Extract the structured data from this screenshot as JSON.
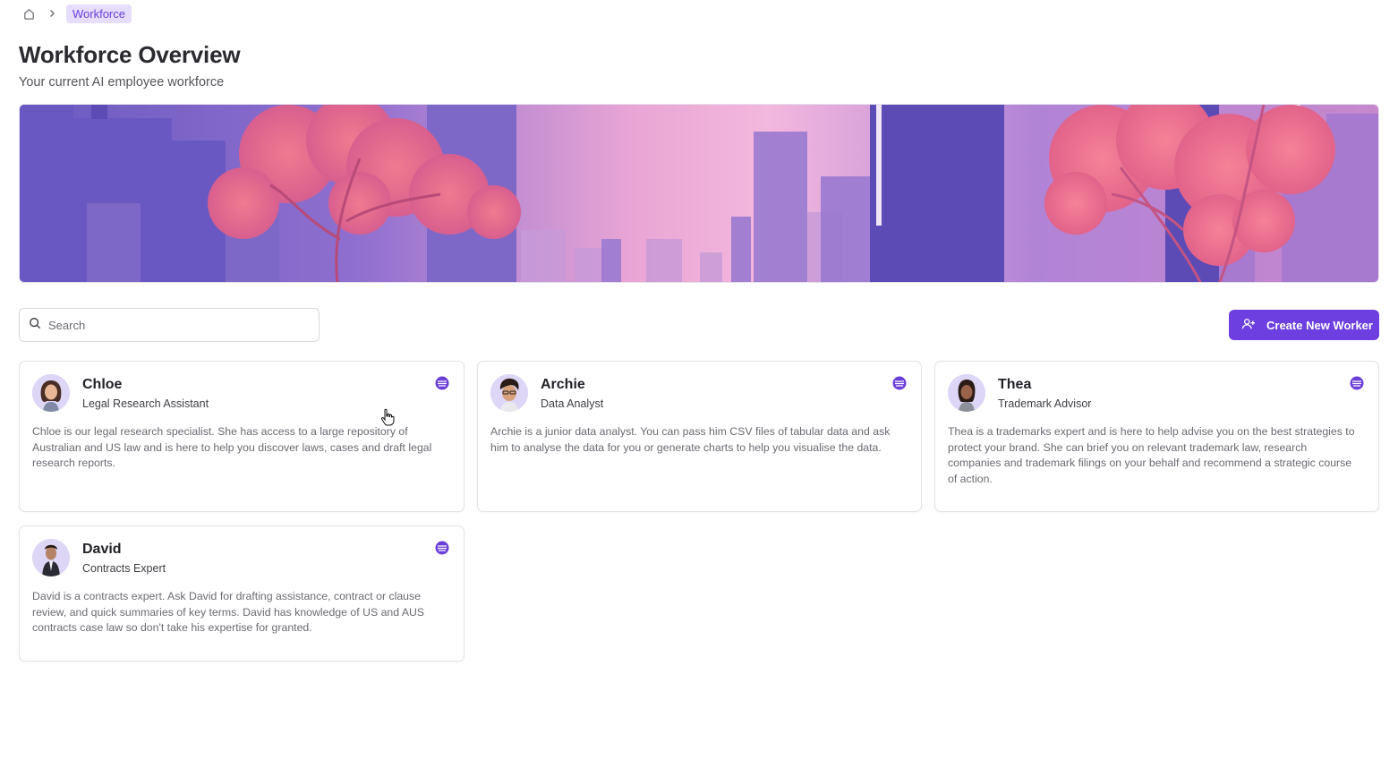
{
  "breadcrumb": {
    "home_icon": "home-icon",
    "separator_icon": "chevron-right-icon",
    "current": "Workforce"
  },
  "header": {
    "title": "Workforce Overview",
    "subtitle": "Your current AI employee workforce"
  },
  "search": {
    "placeholder": "Search",
    "value": "",
    "icon": "search-icon"
  },
  "actions": {
    "create_label": "Create New Worker",
    "create_icon": "user-plus-icon"
  },
  "colors": {
    "accent": "#6d3fe0",
    "breadcrumb_bg": "#e6dcfb"
  },
  "workers": [
    {
      "name": "Chloe",
      "role": "Legal Research Assistant",
      "description": "Chloe is our legal research specialist. She has access to a large repository of Australian and US law and is here to help you discover laws, cases and draft legal research reports.",
      "badge_icon": "stacked-layers-icon"
    },
    {
      "name": "Archie",
      "role": "Data Analyst",
      "description": "Archie is a junior data analyst. You can pass him CSV files of tabular data and ask him to analyse the data for you or generate charts to help you visualise the data.",
      "badge_icon": "stacked-layers-icon"
    },
    {
      "name": "Thea",
      "role": "Trademark Advisor",
      "description": "Thea is a trademarks expert and is here to help advise you on the best strategies to protect your brand. She can brief you on relevant trademark law, research companies and trademark filings on your behalf and recommend a strategic course of action.",
      "badge_icon": "stacked-layers-icon"
    },
    {
      "name": "David",
      "role": "Contracts Expert",
      "description": "David is a contracts expert. Ask David for drafting assistance, contract or clause review, and quick summaries of key terms. David has knowledge of US and AUS contracts case law so don't take his expertise for granted.",
      "badge_icon": "stacked-layers-icon"
    }
  ]
}
